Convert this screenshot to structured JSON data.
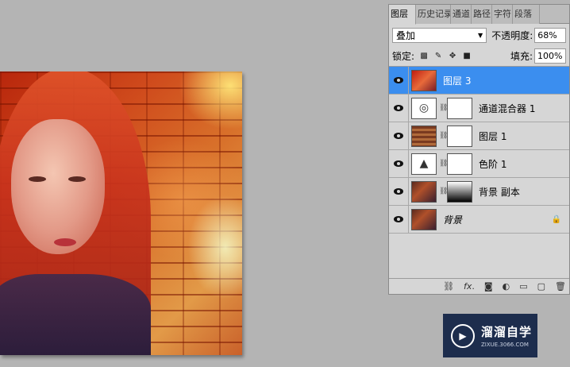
{
  "panel": {
    "tabs": [
      "图层",
      "历史记录",
      "通道",
      "路径",
      "字符",
      "段落"
    ],
    "blend_mode": "叠加",
    "opacity_label": "不透明度:",
    "opacity_value": "68%",
    "lock_label": "锁定:",
    "fill_label": "填充:",
    "fill_value": "100%",
    "layers": [
      {
        "name": "图层 3",
        "selected": true
      },
      {
        "name": "通道混合器 1",
        "selected": false
      },
      {
        "name": "图层 1",
        "selected": false
      },
      {
        "name": "色阶 1",
        "selected": false
      },
      {
        "name": "背景 副本",
        "selected": false
      },
      {
        "name": "背景",
        "selected": false
      }
    ]
  },
  "watermark": {
    "title": "溜溜自学",
    "url": "ZIXUE.3066.COM"
  },
  "colors": {
    "selection": "#3b8eef",
    "panel_bg": "#d6d6d6",
    "workspace": "#b4b4b4"
  }
}
